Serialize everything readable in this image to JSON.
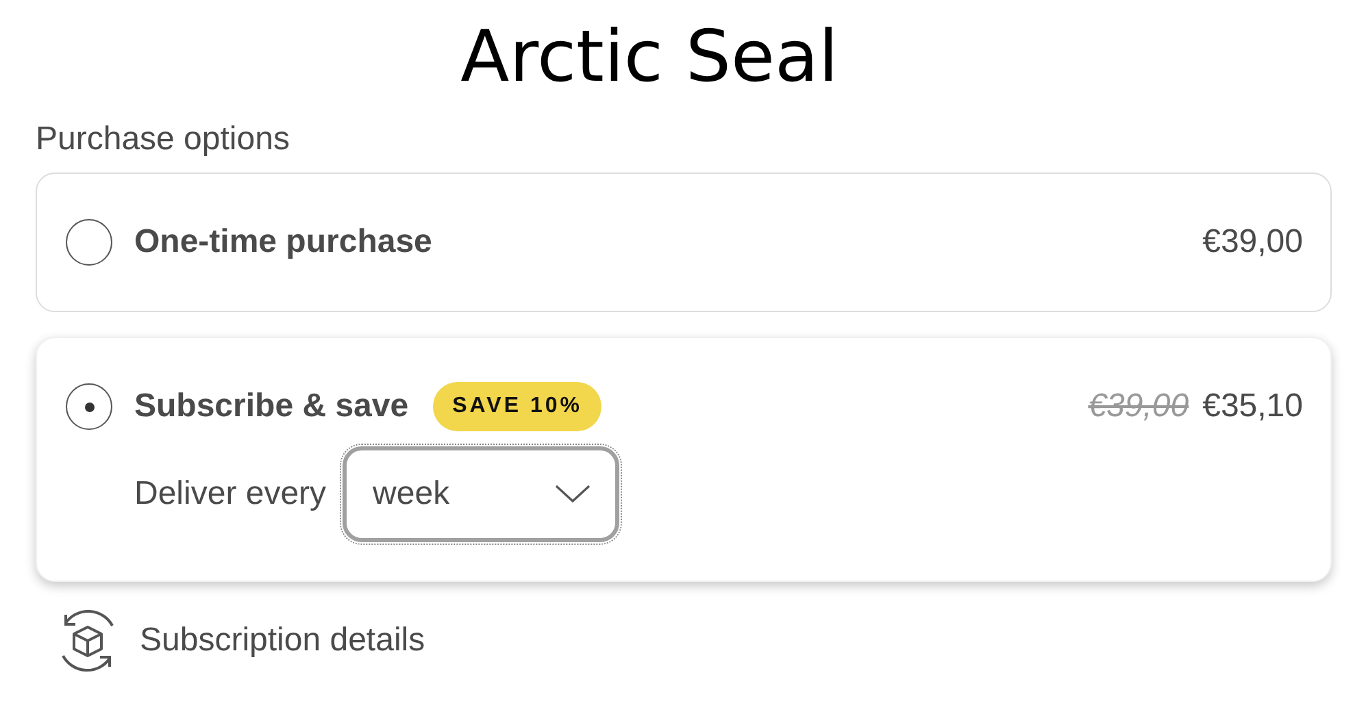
{
  "title": "Arctic Seal",
  "section_label": "Purchase options",
  "options": [
    {
      "label": "One-time purchase",
      "selected": false,
      "price": "€39,00"
    },
    {
      "label": "Subscribe & save",
      "selected": true,
      "badge": "SAVE 10%",
      "old_price": "€39,00",
      "price": "€35,10",
      "frequency": {
        "label": "Deliver every",
        "value": "week"
      }
    }
  ],
  "details_link": "Subscription details"
}
